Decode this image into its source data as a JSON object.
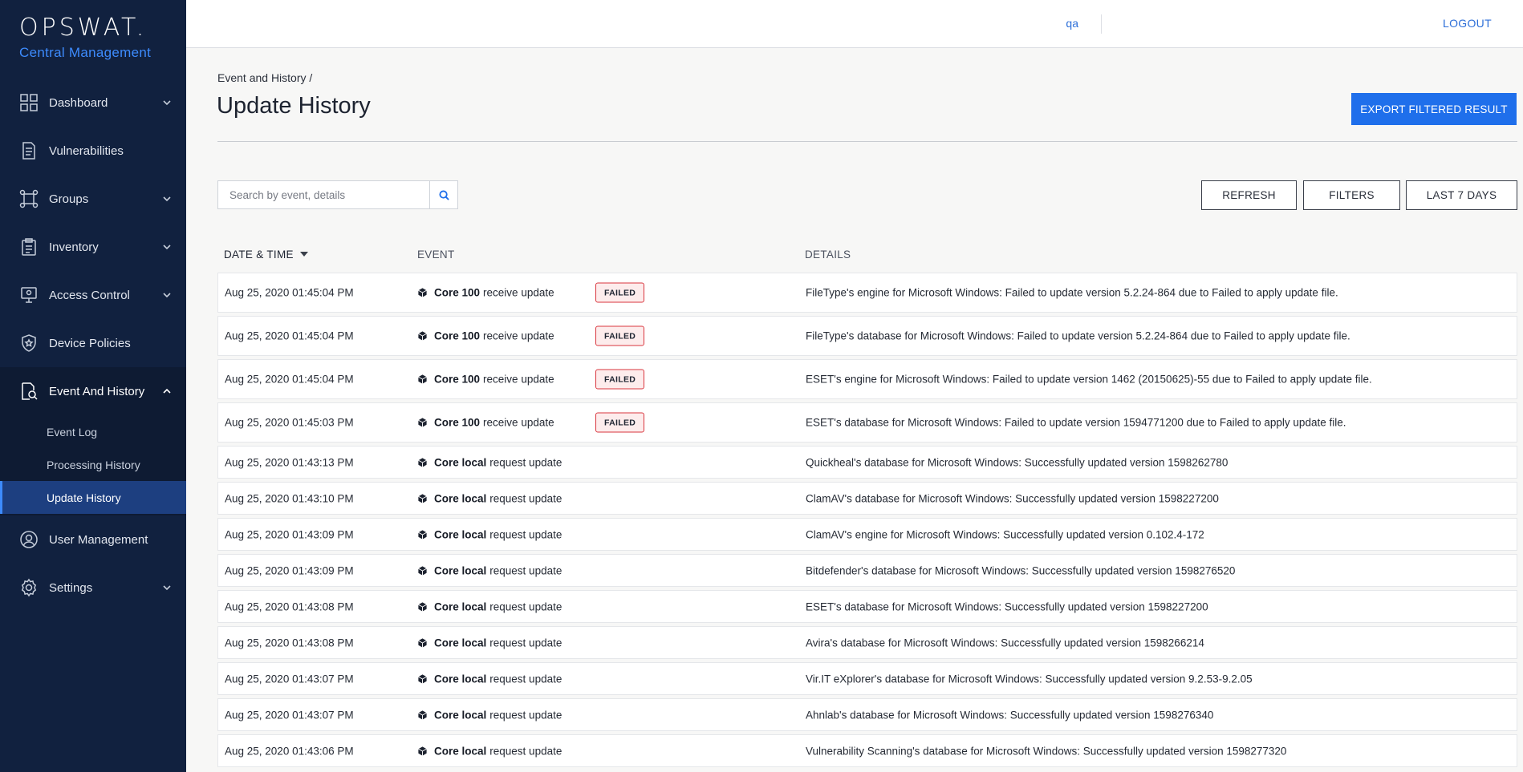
{
  "brand": {
    "name": "OPSWAT.",
    "subtitle": "Central Management"
  },
  "topbar": {
    "user": "qa",
    "logout": "LOGOUT"
  },
  "sidebar": {
    "items": [
      {
        "label": "Dashboard",
        "icon": "dashboard-icon",
        "expandable": true
      },
      {
        "label": "Vulnerabilities",
        "icon": "document-icon",
        "expandable": false
      },
      {
        "label": "Groups",
        "icon": "groups-icon",
        "expandable": true
      },
      {
        "label": "Inventory",
        "icon": "clipboard-icon",
        "expandable": true
      },
      {
        "label": "Access Control",
        "icon": "access-control-icon",
        "expandable": true
      },
      {
        "label": "Device Policies",
        "icon": "shield-icon",
        "expandable": false
      },
      {
        "label": "Event And History",
        "icon": "search-history-icon",
        "expandable": true,
        "expanded": true,
        "children": [
          {
            "label": "Event Log"
          },
          {
            "label": "Processing History"
          },
          {
            "label": "Update History",
            "active": true
          }
        ]
      },
      {
        "label": "User Management",
        "icon": "user-icon",
        "expandable": false
      },
      {
        "label": "Settings",
        "icon": "gear-icon",
        "expandable": true
      }
    ]
  },
  "page": {
    "breadcrumb": "Event and History /",
    "title": "Update History",
    "export_label": "EXPORT FILTERED RESULT"
  },
  "search": {
    "placeholder": "Search by event, details"
  },
  "toolbar": {
    "refresh": "REFRESH",
    "filters": "FILTERS",
    "range": "LAST 7 DAYS"
  },
  "table": {
    "headers": {
      "date": "DATE & TIME",
      "event": "EVENT",
      "details": "DETAILS"
    },
    "rows": [
      {
        "date": "Aug 25, 2020 01:45:04 PM",
        "source": "Core 100",
        "action": "receive update",
        "status": "FAILED",
        "details": "FileType's engine for Microsoft Windows: Failed to update version 5.2.24-864 due to Failed to apply update file."
      },
      {
        "date": "Aug 25, 2020 01:45:04 PM",
        "source": "Core 100",
        "action": "receive update",
        "status": "FAILED",
        "details": "FileType's database for Microsoft Windows: Failed to update version 5.2.24-864 due to Failed to apply update file."
      },
      {
        "date": "Aug 25, 2020 01:45:04 PM",
        "source": "Core 100",
        "action": "receive update",
        "status": "FAILED",
        "details": "ESET's engine for Microsoft Windows: Failed to update version 1462 (20150625)-55 due to Failed to apply update file."
      },
      {
        "date": "Aug 25, 2020 01:45:03 PM",
        "source": "Core 100",
        "action": "receive update",
        "status": "FAILED",
        "details": "ESET's database for Microsoft Windows: Failed to update version 1594771200 due to Failed to apply update file."
      },
      {
        "date": "Aug 25, 2020 01:43:13 PM",
        "source": "Core local",
        "action": "request update",
        "status": "",
        "details": "Quickheal's database for Microsoft Windows: Successfully updated version 1598262780"
      },
      {
        "date": "Aug 25, 2020 01:43:10 PM",
        "source": "Core local",
        "action": "request update",
        "status": "",
        "details": "ClamAV's database for Microsoft Windows: Successfully updated version 1598227200"
      },
      {
        "date": "Aug 25, 2020 01:43:09 PM",
        "source": "Core local",
        "action": "request update",
        "status": "",
        "details": "ClamAV's engine for Microsoft Windows: Successfully updated version 0.102.4-172"
      },
      {
        "date": "Aug 25, 2020 01:43:09 PM",
        "source": "Core local",
        "action": "request update",
        "status": "",
        "details": "Bitdefender's database for Microsoft Windows: Successfully updated version 1598276520"
      },
      {
        "date": "Aug 25, 2020 01:43:08 PM",
        "source": "Core local",
        "action": "request update",
        "status": "",
        "details": "ESET's database for Microsoft Windows: Successfully updated version 1598227200"
      },
      {
        "date": "Aug 25, 2020 01:43:08 PM",
        "source": "Core local",
        "action": "request update",
        "status": "",
        "details": "Avira's database for Microsoft Windows: Successfully updated version 1598266214"
      },
      {
        "date": "Aug 25, 2020 01:43:07 PM",
        "source": "Core local",
        "action": "request update",
        "status": "",
        "details": "Vir.IT eXplorer's database for Microsoft Windows: Successfully updated version 9.2.53-9.2.05"
      },
      {
        "date": "Aug 25, 2020 01:43:07 PM",
        "source": "Core local",
        "action": "request update",
        "status": "",
        "details": "Ahnlab's database for Microsoft Windows: Successfully updated version 1598276340"
      },
      {
        "date": "Aug 25, 2020 01:43:06 PM",
        "source": "Core local",
        "action": "request update",
        "status": "",
        "details": "Vulnerability Scanning's database for Microsoft Windows: Successfully updated version 1598277320"
      }
    ]
  },
  "colors": {
    "sidebar": "#11213f",
    "accent": "#1f6feb",
    "failed_border": "#d9363e",
    "failed_bg": "#fdecec",
    "link": "#2d6fd8"
  }
}
